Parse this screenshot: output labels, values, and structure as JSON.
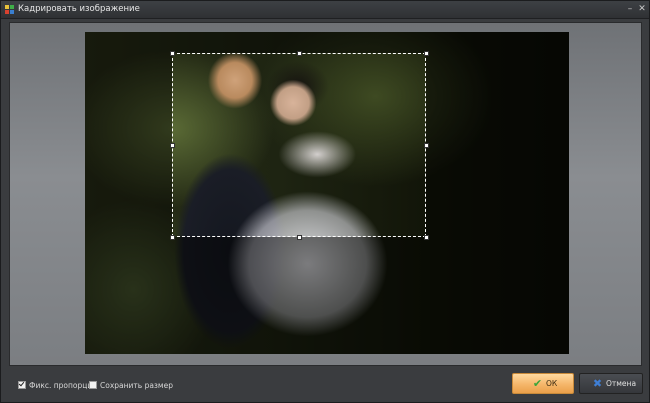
{
  "window": {
    "title": "Кадрировать изображение",
    "minimize_label": "–",
    "close_label": "✕",
    "icon": "app-logo-icon"
  },
  "options": {
    "fix_proportions": {
      "label": "Фикс. пропорции",
      "checked": true
    },
    "keep_size": {
      "label": "Сохранить размер",
      "checked": false
    }
  },
  "buttons": {
    "ok": {
      "label": "ОК",
      "icon": "checkmark-icon",
      "icon_color": "#3aa53a"
    },
    "cancel": {
      "label": "Отмена",
      "icon": "x-icon",
      "icon_color": "#3f7fd6"
    }
  },
  "colors": {
    "accent_ok": "#f5b66a",
    "crop_border": "#ffffff"
  }
}
